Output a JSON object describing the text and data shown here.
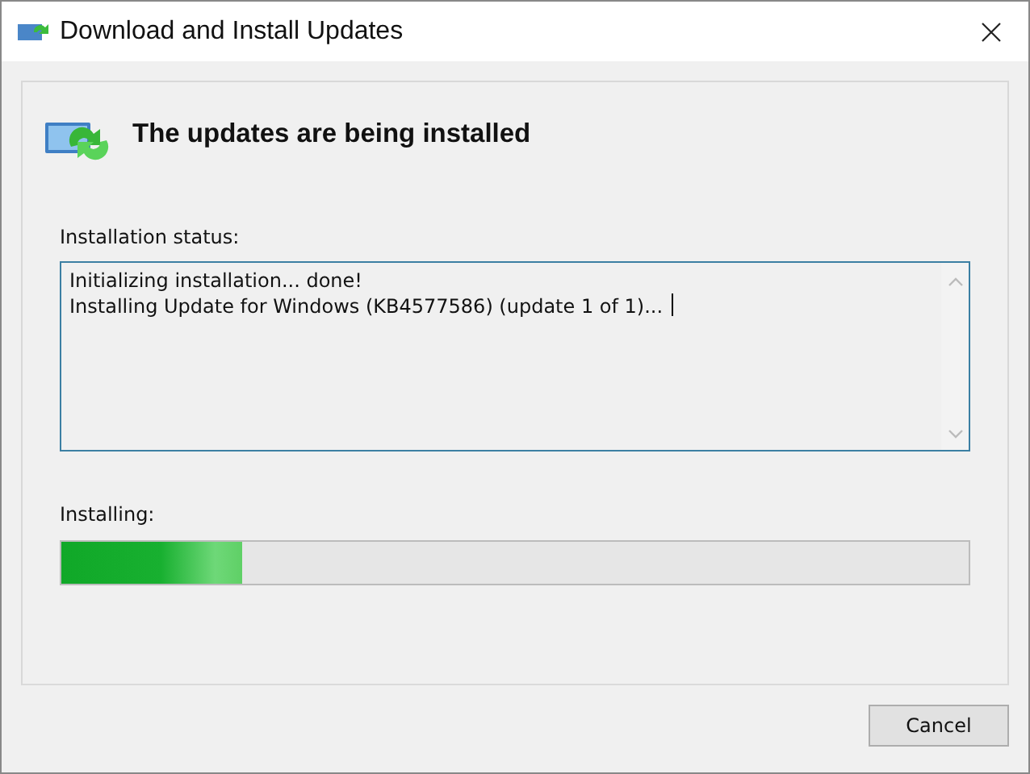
{
  "window": {
    "title": "Download and Install Updates"
  },
  "heading": "The updates are being installed",
  "status": {
    "label": "Installation status:",
    "lines": [
      "Initializing installation... done!",
      "Installing Update for Windows (KB4577586) (update 1 of 1)..."
    ]
  },
  "progress": {
    "label": "Installing:",
    "level": 0.2
  },
  "buttons": [
    {
      "label": "Cancel"
    }
  ]
}
